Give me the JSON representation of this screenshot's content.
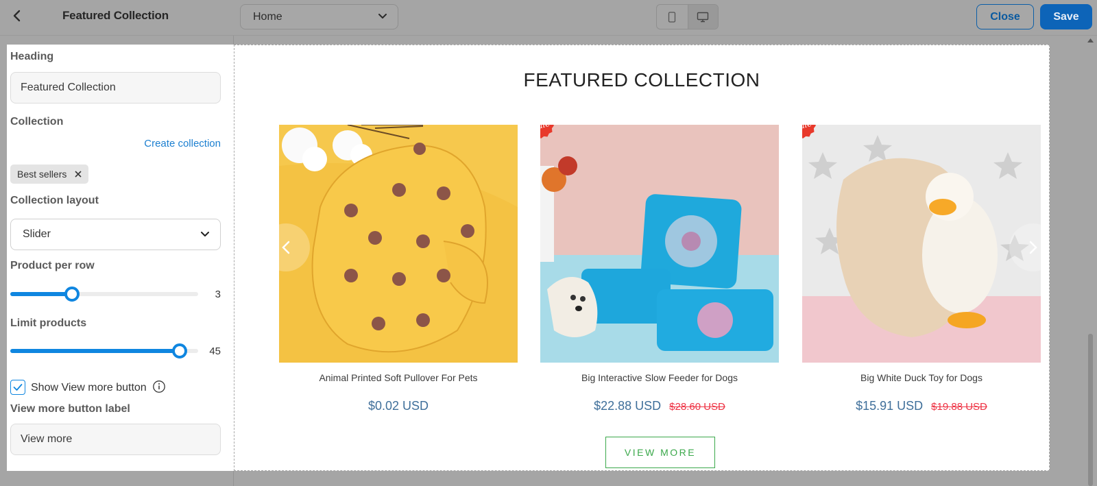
{
  "header": {
    "title": "Featured Collection",
    "page_select": "Home",
    "close_label": "Close",
    "save_label": "Save"
  },
  "settings": {
    "heading_label": "Heading",
    "heading_value": "Featured Collection",
    "collection_label": "Collection",
    "create_collection": "Create collection",
    "collection_tag": "Best sellers",
    "layout_label": "Collection layout",
    "layout_value": "Slider",
    "per_row_label": "Product per row",
    "per_row_value": "3",
    "per_row_fraction": 0.33,
    "limit_label": "Limit products",
    "limit_value": "45",
    "limit_fraction": 0.9,
    "show_view_more_label": "Show View more button",
    "show_view_more_checked": true,
    "view_more_label_title": "View more button label",
    "view_more_label_value": "View more"
  },
  "preview": {
    "section_title": "FEATURED COLLECTION",
    "sale_badge": "Sale",
    "view_more_button": "VIEW MORE",
    "products": [
      {
        "name": "Animal Printed Soft Pullover For Pets",
        "price": "$0.02 USD",
        "compare_price": "",
        "on_sale": false
      },
      {
        "name": "Big Interactive Slow Feeder for Dogs",
        "price": "$22.88 USD",
        "compare_price": "$28.60 USD",
        "on_sale": true
      },
      {
        "name": "Big White Duck Toy for Dogs",
        "price": "$15.91 USD",
        "compare_price": "$19.88 USD",
        "on_sale": true
      }
    ]
  },
  "colors": {
    "accent_blue": "#0f86e0",
    "save_button": "#0d64b8",
    "sale_red": "#ee3344",
    "price_blue": "#3f6f9a",
    "view_more_green": "#3aa84a"
  }
}
